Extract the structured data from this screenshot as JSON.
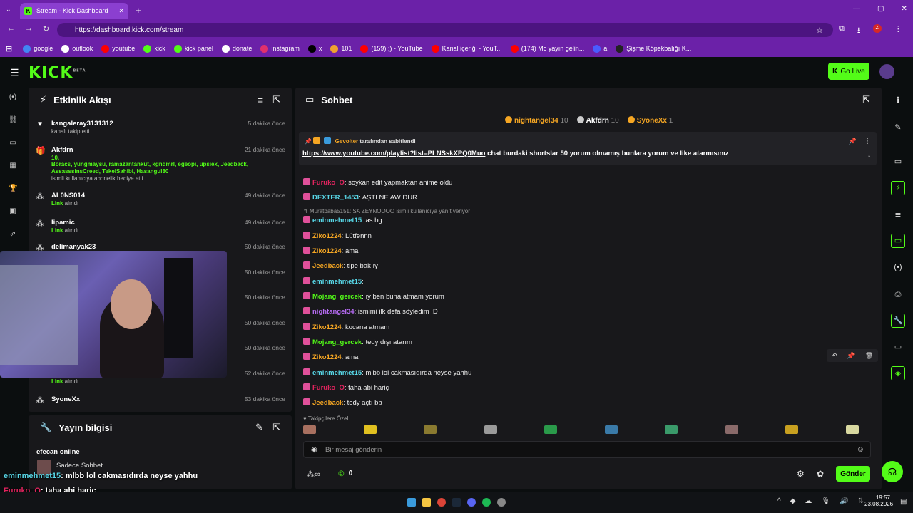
{
  "browser": {
    "tab_title": "Stream - Kick Dashboard",
    "url": "https://dashboard.kick.com/stream",
    "bookmarks": [
      {
        "label": "google",
        "color": "#4285f4"
      },
      {
        "label": "outlook",
        "color": "#ffffff"
      },
      {
        "label": "youtube",
        "color": "#ff0000"
      },
      {
        "label": "kick",
        "color": "#53fc18"
      },
      {
        "label": "kick panel",
        "color": "#53fc18"
      },
      {
        "label": "donate",
        "color": "#ffffff"
      },
      {
        "label": "instagram",
        "color": "#e1306c"
      },
      {
        "label": "x",
        "color": "#000000"
      },
      {
        "label": "101",
        "color": "#f0a030"
      },
      {
        "label": "(159) ;) - YouTube",
        "color": "#ff0000"
      },
      {
        "label": "Kanal içeriği - YouT...",
        "color": "#ff0000"
      },
      {
        "label": "(174) Mc yayın gelin...",
        "color": "#ff0000"
      },
      {
        "label": "a",
        "color": "#4a5cff"
      },
      {
        "label": "Şişme Köpekbalığı K...",
        "color": "#222222"
      }
    ]
  },
  "header": {
    "logo": "KICK",
    "logo_beta": "BETA",
    "go_live": "Go Live"
  },
  "activity": {
    "title": "Etkinlik Akışı",
    "items": [
      {
        "name": "kangaleray3131312",
        "time": "5 dakika önce",
        "sub": "kanalı takip etti",
        "icon": "heart-icon"
      },
      {
        "name": "Akfdrn",
        "time": "21 dakika önce",
        "sub_count": "10,",
        "sub_users": "Boracs, yungmaysu, ramazantankut, kgndmrl, egeopi, upsiex, Jeedback, AssasssinsCreed, TekelSahibi, Hasangul80",
        "sub": "isimli kullanıcıya abonelik hediye etti.",
        "icon": "gift-icon"
      },
      {
        "name": "AL0NS014",
        "time": "49 dakika önce",
        "link": "Link",
        "link_rest": " alındı",
        "icon": "share-icon"
      },
      {
        "name": "lipamic",
        "time": "49 dakika önce",
        "link": "Link",
        "link_rest": " alındı",
        "icon": "share-icon"
      },
      {
        "name": "delimanyak23",
        "time": "50 dakika önce",
        "icon": "share-icon"
      },
      {
        "time": "50 dakika önce"
      },
      {
        "time": "50 dakika önce"
      },
      {
        "time": "50 dakika önce"
      },
      {
        "time": "50 dakika önce"
      },
      {
        "time": "52 dakika önce",
        "link": "Link",
        "link_rest": " alındı"
      },
      {
        "name": "SyoneXx",
        "time": "53 dakika önce",
        "icon": "share-icon"
      }
    ]
  },
  "yayin": {
    "title": "Yayın bilgisi",
    "stream_title": "efecan online",
    "category": "Sadece Sohbet"
  },
  "chat": {
    "title": "Sohbet",
    "top_gifters": [
      {
        "name": "nightangel34",
        "count": "10",
        "color": "#f5a623"
      },
      {
        "name": "Akfdrn",
        "count": "10",
        "color": "#cccccc"
      },
      {
        "name": "SyoneXx",
        "count": "1",
        "color": "#f5a623"
      }
    ],
    "pinned": {
      "by_user": "Gevolter",
      "by_text": "tarafından sabitlendi",
      "link": "https://www.youtube.com/playlist?list=PLNSskXPQ0Muo",
      "text": " chat burdaki shortslar 50 yorum olmamış bunlara yorum ve like atarmısınız"
    },
    "reply_ctx": "Muratbaba5151: SA ZEYNOOOO isimli kullanıcıya yanıt veriyor",
    "messages": [
      {
        "user": "Furuko_O",
        "color": "#e0245e",
        "text": ": soykan edit yapmaktan anime oldu"
      },
      {
        "user": "DEXTER_1453",
        "color": "#58d8e8",
        "text": ": AŞTI NE AW DUR"
      },
      {
        "user": "eminmehmet15",
        "color": "#58d8e8",
        "text": ": as hg"
      },
      {
        "user": "Ziko1224",
        "color": "#f5a623",
        "text": ": Lütfennn"
      },
      {
        "user": "Ziko1224",
        "color": "#f5a623",
        "text": ": ama"
      },
      {
        "user": "Jeedback",
        "color": "#f5a623",
        "text": ": tipe bak ıy"
      },
      {
        "user": "eminmehmet15",
        "color": "#58d8e8",
        "text": ": "
      },
      {
        "user": "Mojang_gercek",
        "color": "#53fc18",
        "text": ": ıy ben buna atmam yorum"
      },
      {
        "user": "nightangel34",
        "color": "#b76cf5",
        "text": ": ismimi ilk defa söyledim :D"
      },
      {
        "user": "Ziko1224",
        "color": "#f5a623",
        "text": ": kocana atmam"
      },
      {
        "user": "Mojang_gercek",
        "color": "#53fc18",
        "text": ": tedy dışı atarım"
      },
      {
        "user": "Ziko1224",
        "color": "#f5a623",
        "text": ": ama"
      },
      {
        "user": "eminmehmet15",
        "color": "#58d8e8",
        "text": ": mlbb lol cakmasıdırda neyse yahhu"
      },
      {
        "user": "Furuko_O",
        "color": "#e0245e",
        "text": ": taha abi hariç"
      },
      {
        "user": "Jeedback",
        "color": "#f5a623",
        "text": ": tedy açtı bb"
      }
    ],
    "emote_section": "Takipçilere Özel",
    "input_placeholder": "Bir mesaj gönderin",
    "points": "0",
    "send": "Gönder"
  },
  "overlay": [
    {
      "user": "eminmehmet15",
      "text": ": mlbb lol cakmasıdırda neyse yahhu",
      "color": "#58d8e8"
    },
    {
      "user": "Furuko_O",
      "text": ": taha abi hariç",
      "color": "#e0245e"
    },
    {
      "user": "Jeedback",
      "text": ": tedy açtı bb",
      "color": "#f5a623"
    }
  ],
  "taskbar": {
    "time": "19:57",
    "date": "23.08.2026"
  }
}
